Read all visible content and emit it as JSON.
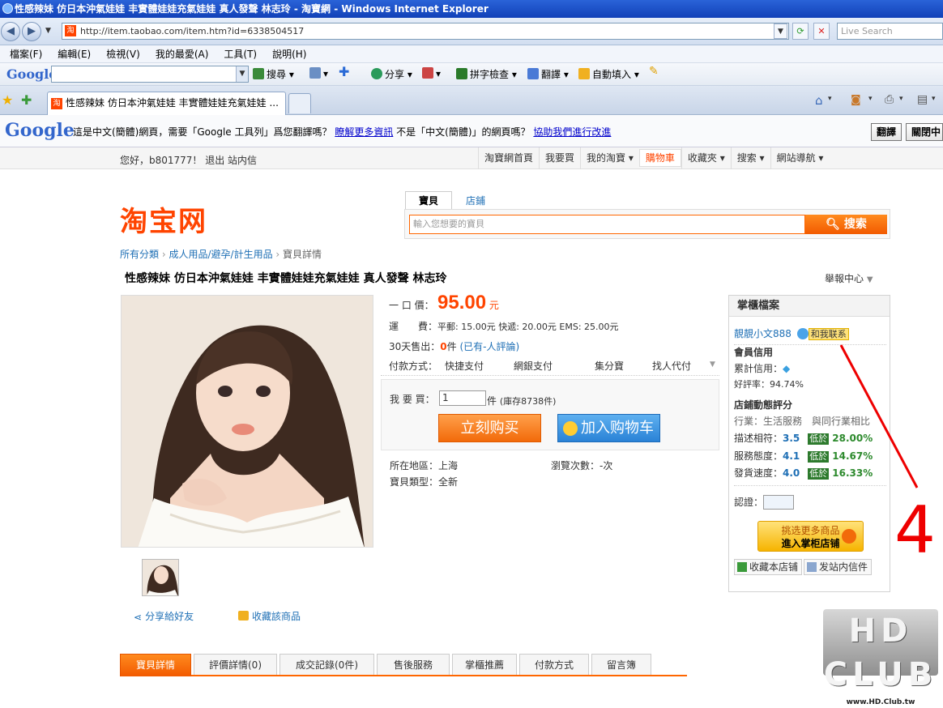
{
  "window": {
    "title": "性感辣妹 仿日本沖氣娃娃 丰實體娃娃充氣娃娃 真人發聲 林志玲 - 淘寶網 - Windows Internet Explorer"
  },
  "address": {
    "url": "http://item.taobao.com/item.htm?id=6338504517",
    "search_placeholder": "Live Search",
    "fav": "淘"
  },
  "menu": {
    "items": [
      "檔案(F)",
      "編輯(E)",
      "檢視(V)",
      "我的最愛(A)",
      "工具(T)",
      "說明(H)"
    ]
  },
  "google_toolbar": {
    "logo": "Google",
    "search": "搜尋",
    "share": "分享",
    "spellcheck": "拼字檢查",
    "translate": "翻譯",
    "autofill": "自動填入"
  },
  "tabs": {
    "active_title": "性感辣妹 仿日本沖氣娃娃 丰實體娃娃充氣娃娃 ...",
    "fav": "淘"
  },
  "translate_bar": {
    "logo": "Google",
    "msg1": "這是中文(簡體)網頁，需要「Google 工具列」爲您翻譯嗎？",
    "link1": "瞭解更多資訊",
    "msg2": "不是「中文(簡體)」的網頁嗎？",
    "link2": "協助我們進行改進",
    "btn_translate": "翻譯",
    "btn_close": "關閉中"
  },
  "site_top": {
    "greeting": "您好，b801777！ 退出  站内信",
    "nav": [
      "淘寶網首頁",
      "我要買",
      "我的淘寶 ▾",
      "購物車",
      "收藏夾 ▾",
      "搜索 ▾",
      "網站導航 ▾"
    ]
  },
  "header": {
    "logo": "淘宝网",
    "tab_item": "寶貝",
    "tab_shop": "店鋪",
    "search_placeholder": "輸入您想要的寶貝",
    "search_button": "搜索"
  },
  "breadcrumb": {
    "items": [
      "所有分類",
      "成人用品/避孕/計生用品",
      "寶貝詳情"
    ]
  },
  "product": {
    "title": "性感辣妹  仿日本沖氣娃娃  丰實體娃娃充氣娃娃  真人發聲  林志玲",
    "report": "舉報中心",
    "price_label": "一 口 價：",
    "price": "95.00",
    "price_unit": "元",
    "shipping_label": "運　　費：",
    "shipping": "平郵: 15.00元 快遞: 20.00元 EMS: 25.00元",
    "sold_label": "30天售出：",
    "sold": "0",
    "sold_unit": "件",
    "comment": "(已有-人評論)",
    "pay_label": "付款方式：",
    "pay_methods": [
      "快捷支付",
      "網銀支付",
      "集分寶",
      "找人代付"
    ],
    "buy_label": "我 要 買：",
    "qty": "1",
    "qty_unit": "件",
    "stock": "(庫存8738件)",
    "buy_now": "立刻购买",
    "add_cart": "加入购物车",
    "location_label": "所在地區：",
    "location": "上海",
    "views_label": "瀏覽次數：",
    "views": "-次",
    "type_label": "寶貝類型：",
    "type": "全新",
    "share": "分享給好友",
    "favorite": "收藏該商品"
  },
  "seller": {
    "header": "掌櫃檔案",
    "name": "靚靚小文888",
    "contact": "和我联系",
    "credit_title": "會員信用",
    "credit_label": "累計信用：",
    "rating_label": "好評率：",
    "rating": "94.74%",
    "dynamic_title": "店鋪動態評分",
    "industry": "行業：生活服務",
    "compare": "與同行業相比",
    "metrics": [
      {
        "label": "描述相符：",
        "score": "3.5",
        "badge": "低於",
        "pct": "28.00%"
      },
      {
        "label": "服務態度：",
        "score": "4.1",
        "badge": "低於",
        "pct": "14.67%"
      },
      {
        "label": "發貨速度：",
        "score": "4.0",
        "badge": "低於",
        "pct": "16.33%"
      }
    ],
    "cert_label": "認證：",
    "enter_line1": "挑选更多商品",
    "enter_line2": "進入掌柜店铺",
    "fav_store": "收藏本店铺",
    "send_msg": "发站内信件"
  },
  "annotation": {
    "number": "4"
  },
  "detail_tabs": {
    "items": [
      {
        "label": "寶貝詳情"
      },
      {
        "label": "評價詳情",
        "count": "(0)"
      },
      {
        "label": "成交記錄",
        "count": "(0件)"
      },
      {
        "label": "售後服務"
      },
      {
        "label": "掌櫃推薦"
      },
      {
        "label": "付款方式"
      },
      {
        "label": "留言簿"
      }
    ]
  },
  "watermark": {
    "text": "HD CLUB",
    "url": "www.HD.Club.tw"
  }
}
